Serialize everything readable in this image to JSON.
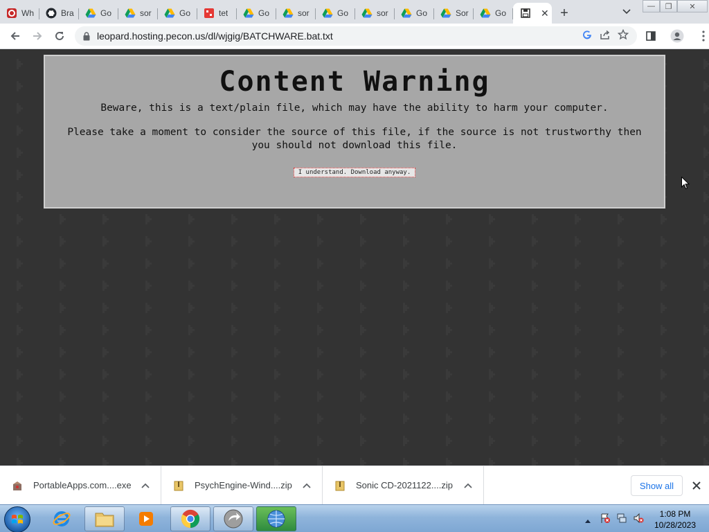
{
  "browser": {
    "tabs": [
      {
        "title": "Wh",
        "icon": "cloud-app-icon"
      },
      {
        "title": "Bra",
        "icon": "github-icon"
      },
      {
        "title": "Go",
        "icon": "google-drive-icon"
      },
      {
        "title": "sor",
        "icon": "google-drive-icon"
      },
      {
        "title": "Go",
        "icon": "google-drive-icon"
      },
      {
        "title": "tet",
        "icon": "game-icon"
      },
      {
        "title": "Go",
        "icon": "google-drive-icon"
      },
      {
        "title": "sor",
        "icon": "google-drive-icon"
      },
      {
        "title": "Go",
        "icon": "google-drive-icon"
      },
      {
        "title": "sor",
        "icon": "google-drive-icon"
      },
      {
        "title": "Go",
        "icon": "google-drive-icon"
      },
      {
        "title": "Sor",
        "icon": "google-drive-icon"
      },
      {
        "title": "Go",
        "icon": "google-drive-icon"
      }
    ],
    "active_tab": {
      "icon": "save-file-icon",
      "close": "✕"
    },
    "new_tab": "+",
    "url": "leopard.hosting.pecon.us/dl/wjgig/BATCHWARE.bat.txt"
  },
  "page": {
    "title": "Content Warning",
    "line1": "Beware, this is a text/plain file, which may have the ability to harm your computer.",
    "line2": "Please take a moment to consider the source of this file, if the source is not trustworthy then you should not download this file.",
    "button": "I understand. Download anyway."
  },
  "downloads": {
    "items": [
      {
        "name": "PortableApps.com....exe",
        "icon": "installer-icon"
      },
      {
        "name": "PsychEngine-Wind....zip",
        "icon": "zip-icon"
      },
      {
        "name": "Sonic CD-2021122....zip",
        "icon": "zip-icon"
      }
    ],
    "show_all": "Show all"
  },
  "taskbar": {
    "time": "1:08 PM",
    "date": "10/28/2023"
  },
  "colors": {
    "page_bg": "#202020",
    "pattern": "#3a3a3a",
    "warning_box": "#a7a7a7",
    "link_blue": "#1a73e8"
  }
}
